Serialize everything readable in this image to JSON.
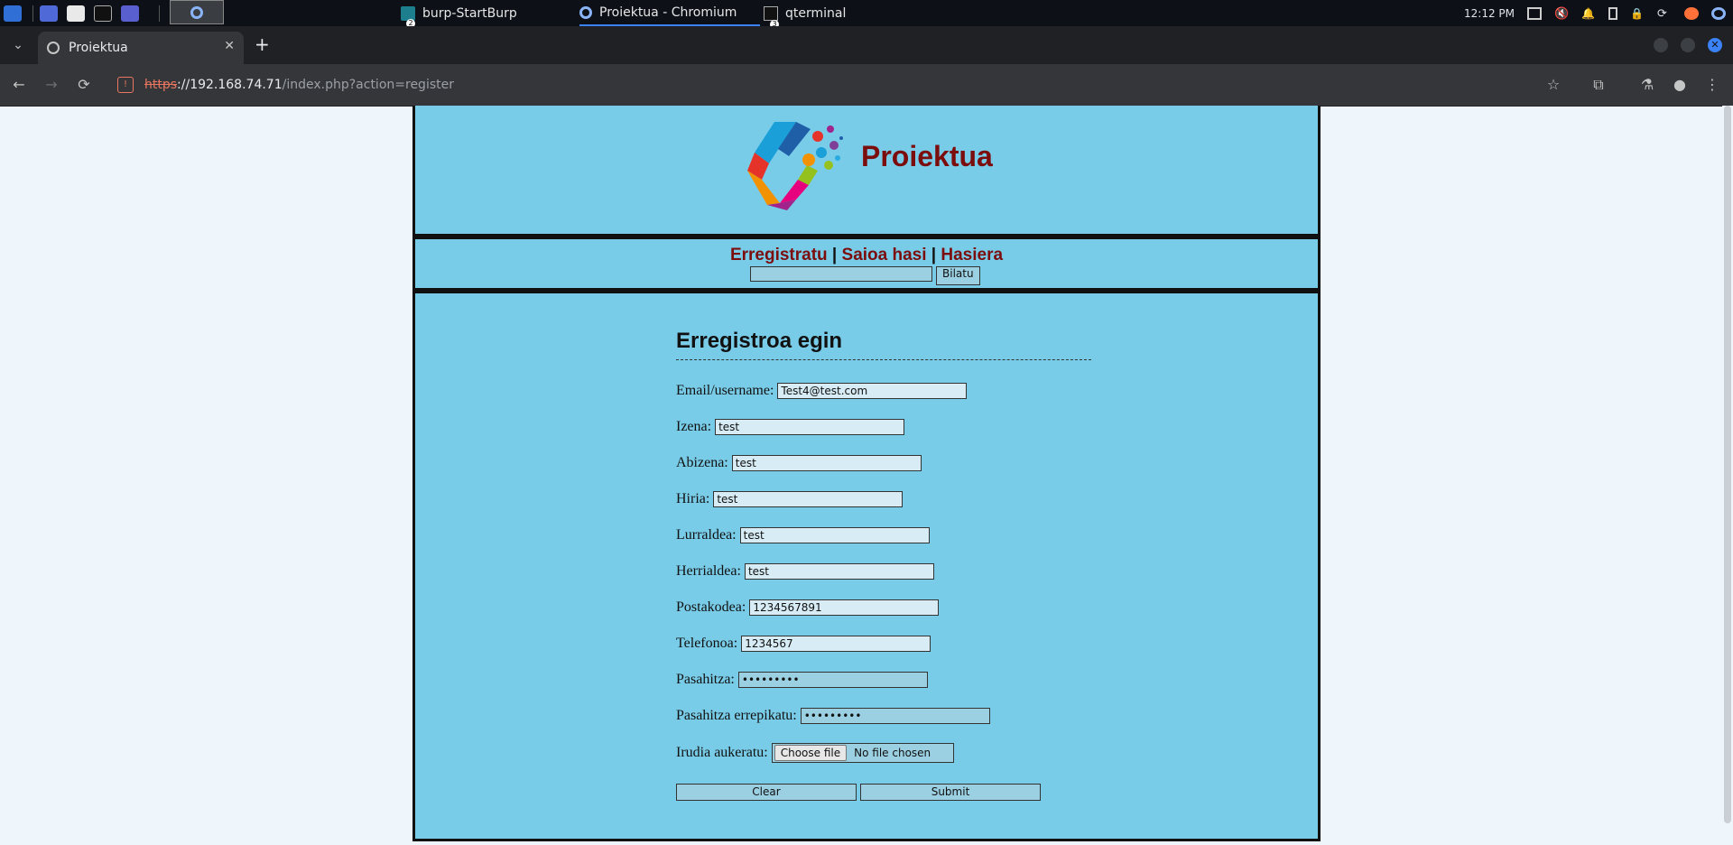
{
  "taskbar": {
    "windows": [
      {
        "label": "burp-StartBurp",
        "badge": "2"
      },
      {
        "label": "Proiektua - Chromium",
        "badge": ""
      },
      {
        "label": "qterminal",
        "badge": "3"
      }
    ],
    "clock": "12:12 PM"
  },
  "browser": {
    "tab_title": "Proiektua",
    "url_scheme": "https",
    "url_host": "://192.168.74.71",
    "url_path": "/index.php?action=register"
  },
  "site": {
    "title": "Proiektua",
    "nav": {
      "register": "Erregistratu",
      "sep": " | ",
      "login": "Saioa hasi",
      "home": "Hasiera"
    },
    "search_button": "Bilatu"
  },
  "form": {
    "heading": "Erregistroa egin",
    "fields": [
      {
        "label": "Email/username:",
        "value": "Test4@test.com"
      },
      {
        "label": "Izena:",
        "value": "test"
      },
      {
        "label": "Abizena:",
        "value": "test"
      },
      {
        "label": "Hiria:",
        "value": "test"
      },
      {
        "label": "Lurraldea:",
        "value": "test"
      },
      {
        "label": "Herrialdea:",
        "value": "test"
      },
      {
        "label": "Postakodea:",
        "value": "1234567891"
      },
      {
        "label": "Telefonoa:",
        "value": "1234567"
      },
      {
        "label": "Pasahitza:",
        "value": "•••••••••"
      },
      {
        "label": "Pasahitza errepikatu:",
        "value": "•••••••••"
      }
    ],
    "file_label": "Irudia aukeratu:",
    "file_button": "Choose file",
    "file_status": "No file chosen",
    "clear": "Clear",
    "submit": "Submit"
  }
}
